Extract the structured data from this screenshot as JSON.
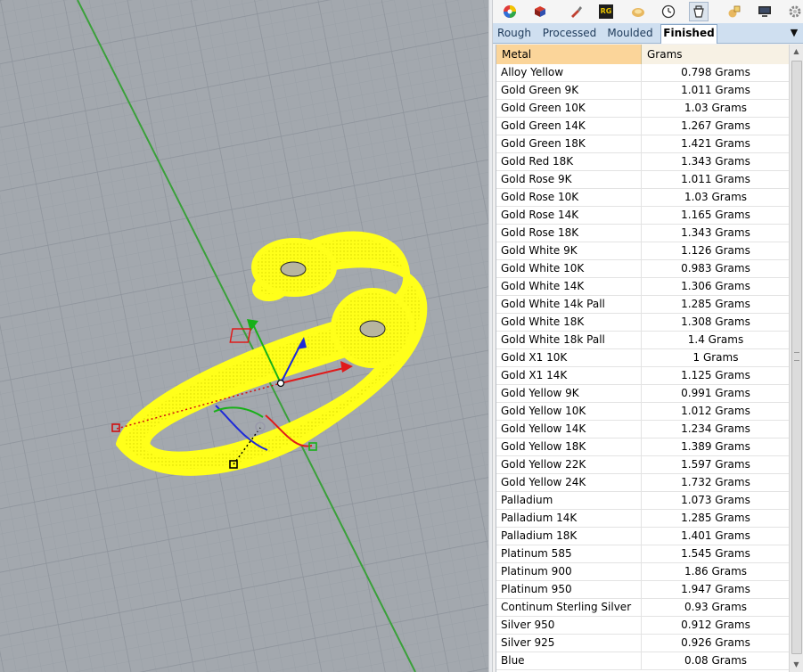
{
  "toolbar": {
    "icons": [
      "color-wheel-icon",
      "material-icon",
      "brush-icon",
      "rg-icon",
      "gem-icon",
      "clock-icon",
      "weight-icon",
      "gems-icon",
      "monitor-icon",
      "gear-icon"
    ],
    "rg_label": "RG"
  },
  "tabs": {
    "items": [
      {
        "label": "Rough",
        "active": false
      },
      {
        "label": "Processed",
        "active": false
      },
      {
        "label": "Moulded",
        "active": false
      },
      {
        "label": "Finished",
        "active": true
      }
    ],
    "menu_glyph": "▼"
  },
  "table": {
    "headers": {
      "metal": "Metal",
      "grams": "Grams"
    },
    "rows": [
      {
        "metal": "Alloy Yellow",
        "grams": "0.798 Grams"
      },
      {
        "metal": "Gold Green 9K",
        "grams": "1.011 Grams"
      },
      {
        "metal": "Gold Green 10K",
        "grams": "1.03 Grams"
      },
      {
        "metal": "Gold Green 14K",
        "grams": "1.267 Grams"
      },
      {
        "metal": "Gold Green 18K",
        "grams": "1.421 Grams"
      },
      {
        "metal": "Gold Red 18K",
        "grams": "1.343 Grams"
      },
      {
        "metal": "Gold Rose 9K",
        "grams": "1.011 Grams"
      },
      {
        "metal": "Gold Rose 10K",
        "grams": "1.03 Grams"
      },
      {
        "metal": "Gold Rose 14K",
        "grams": "1.165 Grams"
      },
      {
        "metal": "Gold Rose 18K",
        "grams": "1.343 Grams"
      },
      {
        "metal": "Gold White 9K",
        "grams": "1.126 Grams"
      },
      {
        "metal": "Gold White 10K",
        "grams": "0.983 Grams"
      },
      {
        "metal": "Gold White 14K",
        "grams": "1.306 Grams"
      },
      {
        "metal": "Gold White 14k Pall",
        "grams": "1.285 Grams"
      },
      {
        "metal": "Gold White 18K",
        "grams": "1.308 Grams"
      },
      {
        "metal": "Gold White 18k Pall",
        "grams": "1.4 Grams"
      },
      {
        "metal": "Gold X1 10K",
        "grams": "1 Grams"
      },
      {
        "metal": "Gold X1 14K",
        "grams": "1.125 Grams"
      },
      {
        "metal": "Gold Yellow 9K",
        "grams": "0.991 Grams"
      },
      {
        "metal": "Gold Yellow 10K",
        "grams": "1.012 Grams"
      },
      {
        "metal": "Gold Yellow 14K",
        "grams": "1.234 Grams"
      },
      {
        "metal": "Gold Yellow 18K",
        "grams": "1.389 Grams"
      },
      {
        "metal": "Gold Yellow 22K",
        "grams": "1.597 Grams"
      },
      {
        "metal": "Gold Yellow 24K",
        "grams": "1.732 Grams"
      },
      {
        "metal": "Palladium",
        "grams": "1.073 Grams"
      },
      {
        "metal": "Palladium 14K",
        "grams": "1.285 Grams"
      },
      {
        "metal": "Palladium 18K",
        "grams": "1.401 Grams"
      },
      {
        "metal": "Platinum 585",
        "grams": "1.545 Grams"
      },
      {
        "metal": "Platinum 900",
        "grams": "1.86 Grams"
      },
      {
        "metal": "Platinum 950",
        "grams": "1.947 Grams"
      },
      {
        "metal": "Continum Sterling Silver",
        "grams": "0.93 Grams"
      },
      {
        "metal": "Silver 950",
        "grams": "0.912 Grams"
      },
      {
        "metal": "Silver 925",
        "grams": "0.926 Grams"
      },
      {
        "metal": "Blue",
        "grams": "0.08 Grams"
      }
    ]
  },
  "viewport": {
    "object_color": "#ffff1a",
    "grid_color": "#939aa2",
    "background": "#a3a8ae",
    "axis_color": "#3aa03a"
  },
  "scrollbar": {
    "up_glyph": "▲",
    "down_glyph": "▼"
  }
}
